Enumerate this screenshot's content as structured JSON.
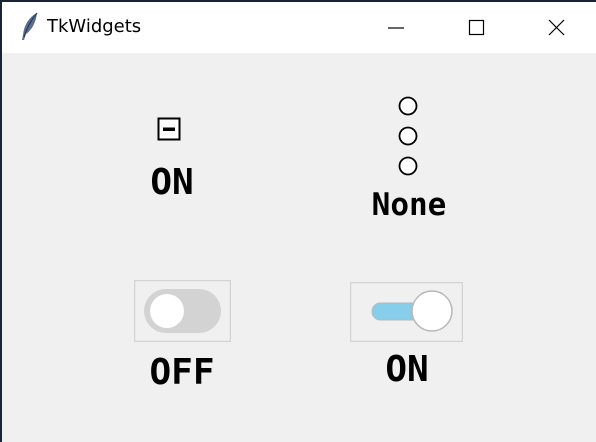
{
  "window": {
    "title": "TkWidgets",
    "app_icon": "feather-icon",
    "controls": [
      "minimize-icon",
      "maximize-icon",
      "close-icon"
    ]
  },
  "checkbox": {
    "state": "indeterminate",
    "label": "ON"
  },
  "radio_group": {
    "options_count": 3,
    "selected": null,
    "label": "None"
  },
  "switch_1": {
    "on": false,
    "label": "OFF",
    "track_color": "#d3d3d3",
    "thumb_color": "#ffffff"
  },
  "switch_2": {
    "on": true,
    "label": "ON",
    "track_color": "#87ceeb",
    "thumb_color": "#ffffff"
  },
  "colors": {
    "window_bg": "#f0f0f0",
    "titlebar_bg": "#ffffff",
    "frame_border": "#d3d3d3"
  }
}
